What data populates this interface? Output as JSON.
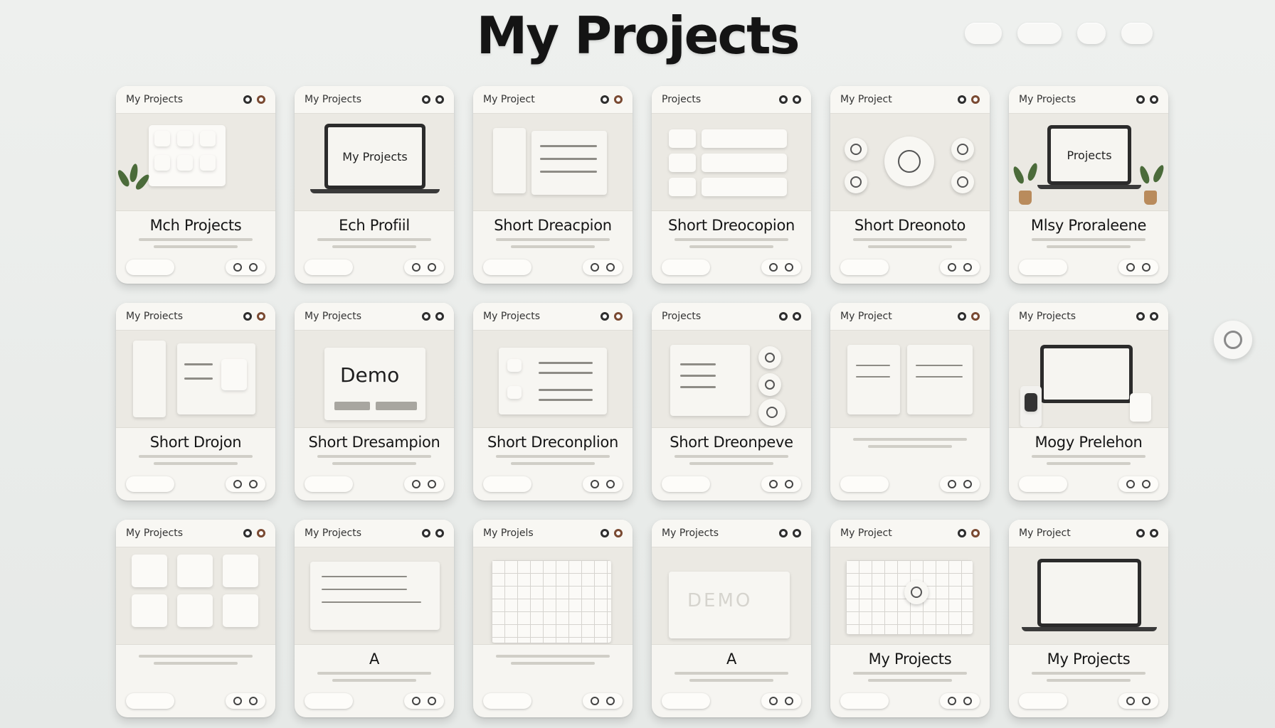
{
  "page": {
    "title": "My Projects",
    "top_controls": [
      "",
      "",
      "",
      ""
    ]
  },
  "cards": [
    {
      "title": "My Projects",
      "heading": "Mch Projects",
      "button": "",
      "thumb": "tiles-plant"
    },
    {
      "title": "My Projects",
      "heading": "Ech Profiil",
      "button": "",
      "thumb": "laptop-my-projects"
    },
    {
      "title": "My Project",
      "heading": "Short Dreacpion",
      "button": "",
      "thumb": "tiles-list"
    },
    {
      "title": "Projects",
      "heading": "Short Dreocopion",
      "button": "",
      "thumb": "icon-rows"
    },
    {
      "title": "My Project",
      "heading": "Short Dreonoto",
      "button": "",
      "thumb": "circle-cluster"
    },
    {
      "title": "My Projects",
      "heading": "Mlsy Proraleene",
      "button": "",
      "thumb": "laptop-projects-plants"
    },
    {
      "title": "My Proiects",
      "heading": "Short Drojon",
      "button": "",
      "thumb": "panels-side"
    },
    {
      "title": "My Projects",
      "heading": "Short Dresampion",
      "button": "",
      "thumb": "demo-card"
    },
    {
      "title": "My Projects",
      "heading": "Short Dreconplion",
      "button": "",
      "thumb": "list-panel"
    },
    {
      "title": "Projects",
      "heading": "Short Dreonpeve",
      "button": "",
      "thumb": "panel-circles"
    },
    {
      "title": "My Project",
      "heading": "",
      "button": "",
      "thumb": "two-panels"
    },
    {
      "title": "My Projects",
      "heading": "Mogy Prelehon",
      "button": "",
      "thumb": "monitor-device"
    },
    {
      "title": "My Projects",
      "heading": "",
      "button": "",
      "thumb": "icon-grid"
    },
    {
      "title": "My Projects",
      "heading": "A",
      "button": "",
      "thumb": "doc-panel"
    },
    {
      "title": "My Projels",
      "heading": "",
      "button": "",
      "thumb": "grid-sheet"
    },
    {
      "title": "My Projects",
      "heading": "A",
      "button": "",
      "thumb": "demo-faint"
    },
    {
      "title": "My Project",
      "heading": "My Projects",
      "button": "",
      "thumb": "grid-graph"
    },
    {
      "title": "My Project",
      "heading": "My Projects",
      "button": "",
      "thumb": "laptop-page"
    }
  ],
  "thumb_text": {
    "laptop_my_projects": "My Projects",
    "laptop_projects": "Projects",
    "demo": "Demo",
    "demo_faint": "DEMO"
  },
  "colors": {
    "background": "#eceeec",
    "card": "#f6f5f1",
    "ink": "#141414",
    "plant": "#4b6b3a"
  }
}
